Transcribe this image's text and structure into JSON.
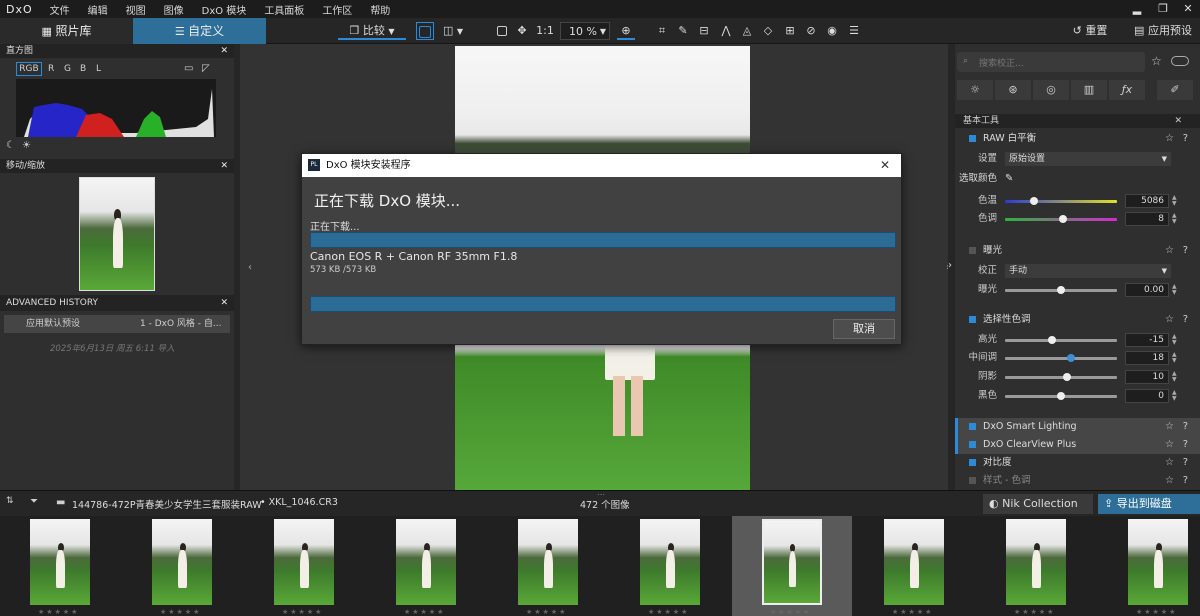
{
  "menubar": {
    "logo": "DxO",
    "items": [
      "文件",
      "编辑",
      "视图",
      "图像",
      "DxO 模块",
      "工具面板",
      "工作区",
      "帮助"
    ],
    "min": "▂",
    "max": "❐",
    "close": "✕"
  },
  "toolbar": {
    "tab_library": "照片库",
    "tab_customize": "自定义",
    "compare": "比较",
    "ratio": "1:1",
    "zoom": "10 %",
    "reset": "重置",
    "apply_preset": "应用预设"
  },
  "left": {
    "histogram_title": "直方图",
    "channels": [
      "RGB",
      "R",
      "G",
      "B",
      "L"
    ],
    "navigator_title": "移动/缩放",
    "history_title": "ADVANCED HISTORY",
    "history_item": "应用默认预设",
    "history_value": "1 - DxO 风格 - 自...",
    "history_date": "2025年6月13日 周五 6:11 导入"
  },
  "right": {
    "search_placeholder": "搜索校正...",
    "section_title": "基本工具",
    "wb_title": "RAW 白平衡",
    "wb_setting_label": "设置",
    "wb_setting_value": "原始设置",
    "picker_label": "选取颜色",
    "temp_label": "色温",
    "temp_value": "5086",
    "temp_fraction": 0.26,
    "tint_label": "色调",
    "tint_value": "8",
    "tint_fraction": 0.52,
    "exposure_title": "曝光",
    "correction_label": "校正",
    "correction_value": "手动",
    "exposure_label": "曝光",
    "exposure_value": "0.00",
    "exposure_fraction": 0.5,
    "selective_title": "选择性色调",
    "highlights_label": "高光",
    "highlights_value": "-15",
    "highlights_fraction": 0.42,
    "midtones_label": "中间调",
    "midtones_value": "18",
    "midtones_fraction": 0.59,
    "shadows_label": "阴影",
    "shadows_value": "10",
    "shadows_fraction": 0.55,
    "blacks_label": "黑色",
    "blacks_value": "0",
    "blacks_fraction": 0.5,
    "smart_lighting": "DxO Smart Lighting",
    "clearview": "DxO ClearView Plus",
    "contrast_title": "对比度",
    "style_title": "样式 - 色调"
  },
  "filmbar": {
    "path": "144786-472P青春美少女学生三套服装RAW",
    "file": "XKL_1046.CR3",
    "count": "472 个图像",
    "nik": "Nik Collection",
    "export": "导出到磁盘"
  },
  "dialog": {
    "title": "DxO 模块安装程序",
    "heading": "正在下载 DxO 模块...",
    "status": "正在下载...",
    "module_name": "Canon EOS R + Canon RF 35mm F1.8",
    "size": "573 KB /573 KB",
    "progress1": 1.0,
    "progress2": 1.0,
    "cancel": "取消",
    "close": "✕"
  },
  "filmstrip": {
    "stars": "★★★★★"
  }
}
